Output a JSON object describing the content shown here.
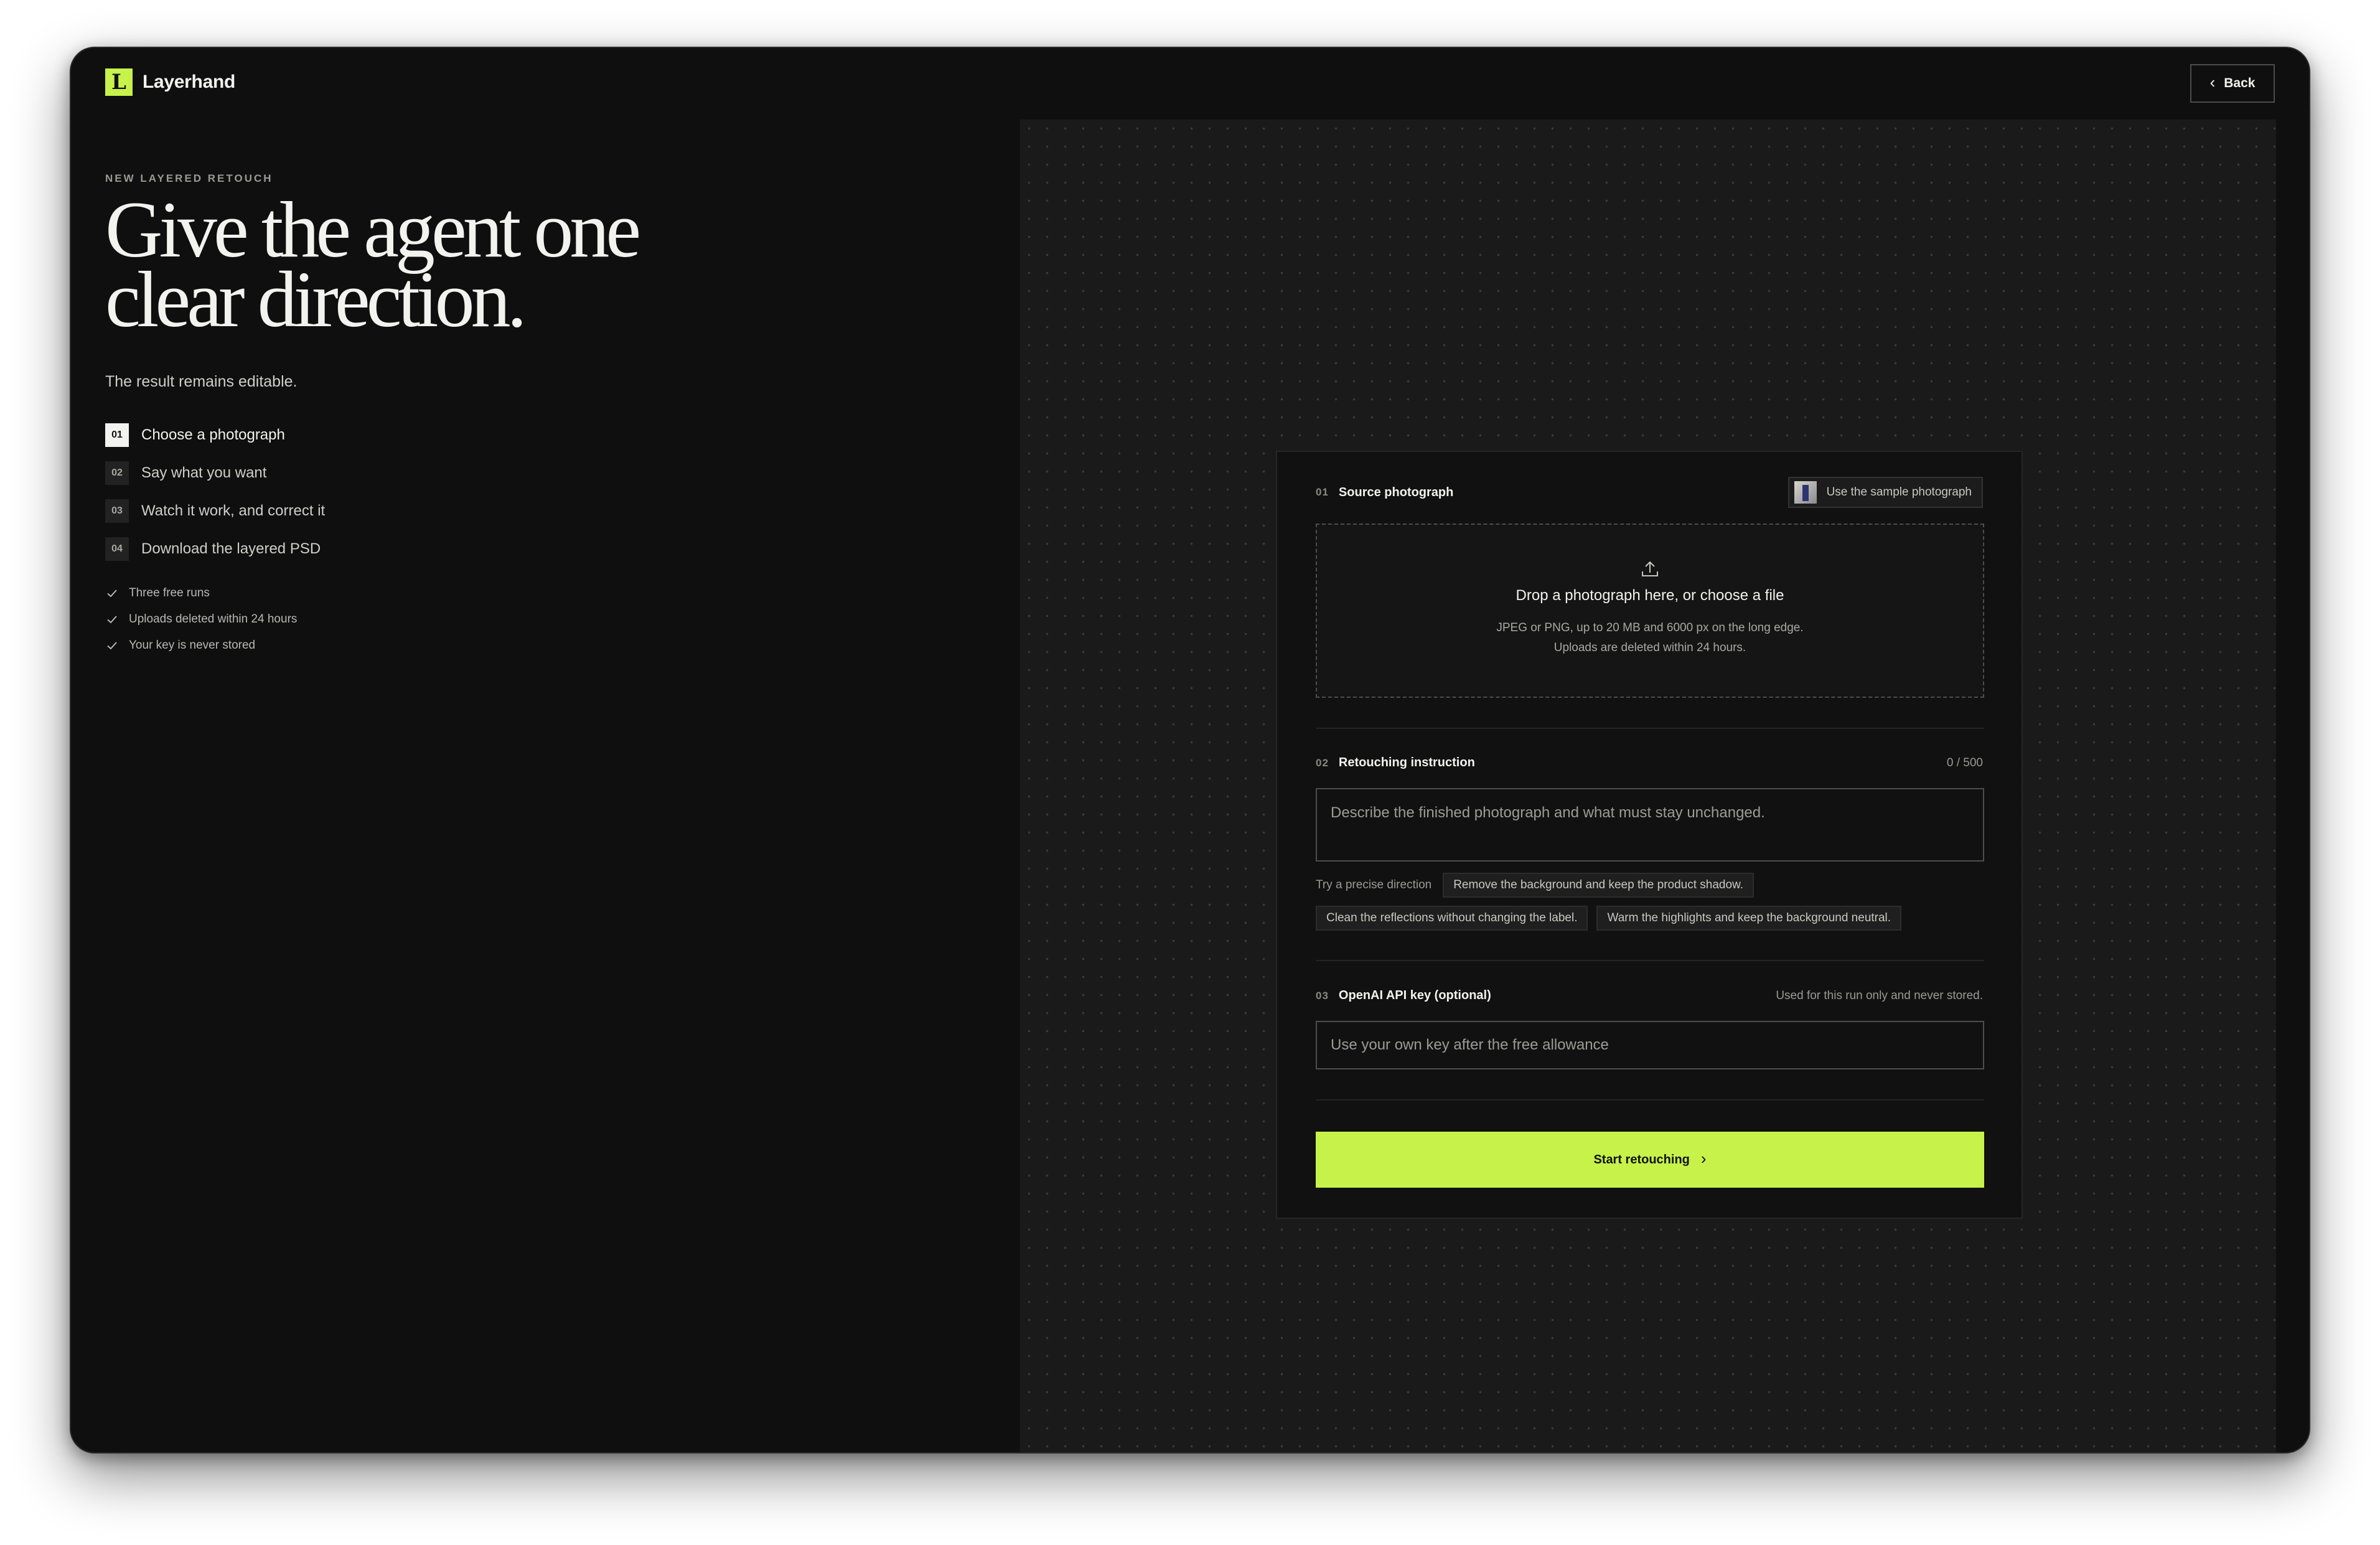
{
  "header": {
    "brand_mark": "L",
    "brand_name": "Layerhand",
    "back_label": "Back"
  },
  "intro": {
    "eyebrow": "NEW LAYERED RETOUCH",
    "headline_line1": "Give the agent one",
    "headline_line2": "clear direction.",
    "subline": "The result remains editable.",
    "steps": [
      {
        "num": "01",
        "label": "Choose a photograph",
        "active": true
      },
      {
        "num": "02",
        "label": "Say what you want",
        "active": false
      },
      {
        "num": "03",
        "label": "Watch it work, and correct it",
        "active": false
      },
      {
        "num": "04",
        "label": "Download the layered PSD",
        "active": false
      }
    ],
    "checks": [
      "Three free runs",
      "Uploads deleted within 24 hours",
      "Your key is never stored"
    ]
  },
  "form": {
    "source": {
      "num": "01",
      "title": "Source photograph",
      "sample_button": "Use the sample photograph",
      "drop_title": "Drop a photograph here, or choose a file",
      "drop_line1": "JPEG or PNG, up to 20 MB and 6000 px on the long edge.",
      "drop_line2": "Uploads are deleted within 24 hours."
    },
    "instruction": {
      "num": "02",
      "title": "Retouching instruction",
      "counter": "0 / 500",
      "placeholder": "Describe the finished photograph and what must stay unchanged.",
      "hint": "Try a precise direction",
      "suggestions": [
        "Remove the background and keep the product shadow.",
        "Clean the reflections without changing the label.",
        "Warm the highlights and keep the background neutral."
      ]
    },
    "api_key": {
      "num": "03",
      "title": "OpenAI API key (optional)",
      "note": "Used for this run only and never stored.",
      "placeholder": "Use your own key after the free allowance"
    },
    "submit_label": "Start retouching"
  },
  "colors": {
    "accent": "#c6f24a",
    "background": "#0f0f0f",
    "panel": "#1a1a1a",
    "text": "#f2f2ee"
  },
  "icons": [
    "back-chevron-icon",
    "upload-icon",
    "check-icon",
    "arrow-right-icon"
  ]
}
